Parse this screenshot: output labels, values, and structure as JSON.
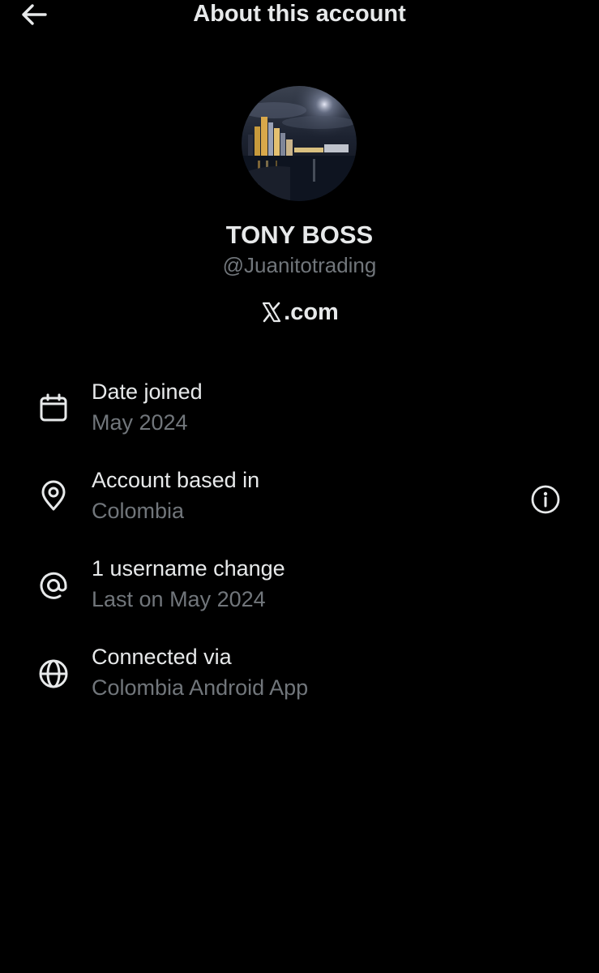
{
  "header": {
    "title": "About this account",
    "back_icon": "arrow-left-icon"
  },
  "profile": {
    "display_name": "TONY BOSS",
    "handle": "@Juanitotrading",
    "site_suffix": ".com",
    "site_logo_icon": "x-logo-icon"
  },
  "details": [
    {
      "icon": "calendar-icon",
      "title": "Date joined",
      "value": "May 2024"
    },
    {
      "icon": "location-pin-icon",
      "title": "Account based in",
      "value": "Colombia",
      "action_icon": "info-icon"
    },
    {
      "icon": "at-sign-icon",
      "title": "1 username change",
      "value": "Last on May 2024"
    },
    {
      "icon": "globe-icon",
      "title": "Connected via",
      "value": "Colombia Android App"
    }
  ],
  "colors": {
    "background": "#000000",
    "primary_text": "#e7e9ea",
    "secondary_text": "#71767b"
  }
}
